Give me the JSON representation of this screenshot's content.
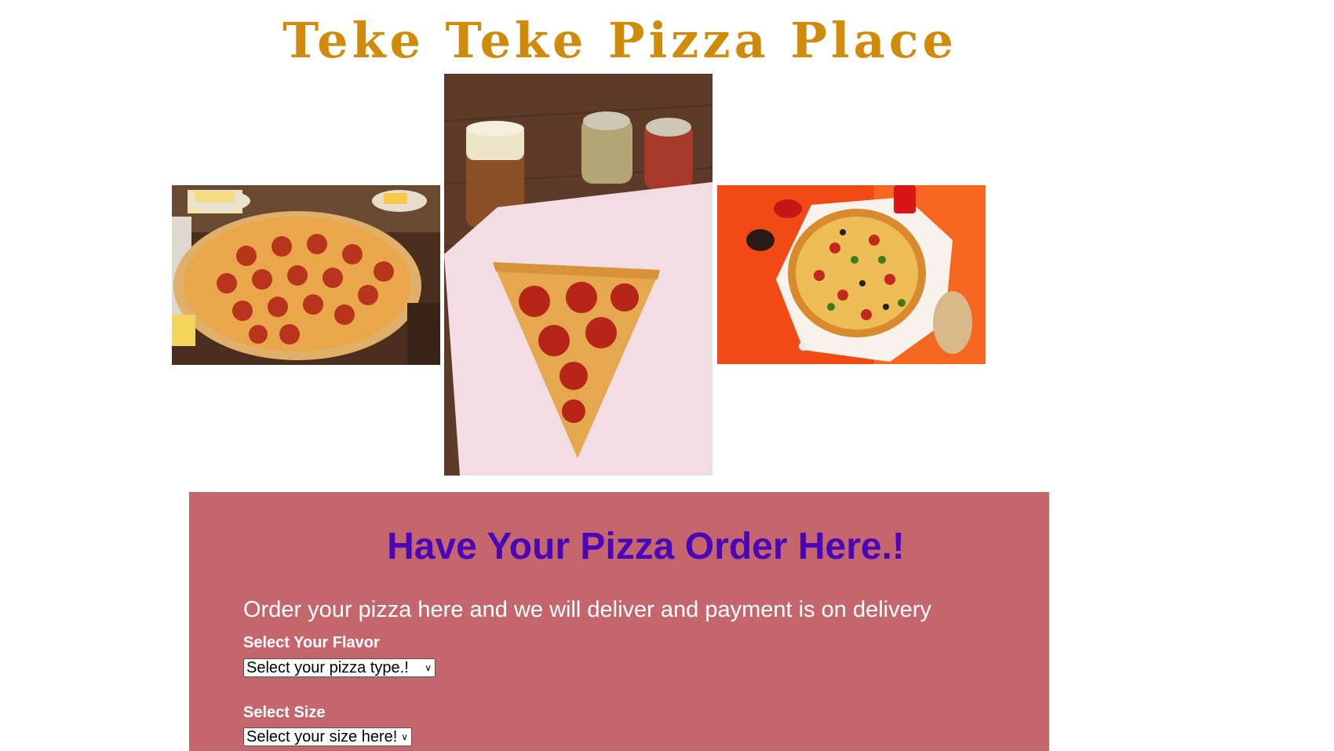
{
  "header": {
    "title": "Teke Teke Pizza Place"
  },
  "gallery": {
    "images": [
      {
        "name": "pepperoni-pizza-photo"
      },
      {
        "name": "pizza-slice-with-beer-photo"
      },
      {
        "name": "veggie-pizza-on-orange-photo"
      }
    ]
  },
  "order": {
    "heading": "Have Your Pizza Order Here.!",
    "intro": "Order your pizza here and we will deliver and payment is on delivery",
    "flavor_label": "Select Your Flavor",
    "flavor_select": "Select your pizza type.!",
    "size_label": "Select Size",
    "size_select": "Select your size here!"
  },
  "colors": {
    "title": "#d18b0b",
    "panel_background": "#c5666d",
    "heading": "#4a06b8",
    "text": "#ffffff"
  },
  "icons": {
    "select_chevron": "chevron-down-icon"
  }
}
